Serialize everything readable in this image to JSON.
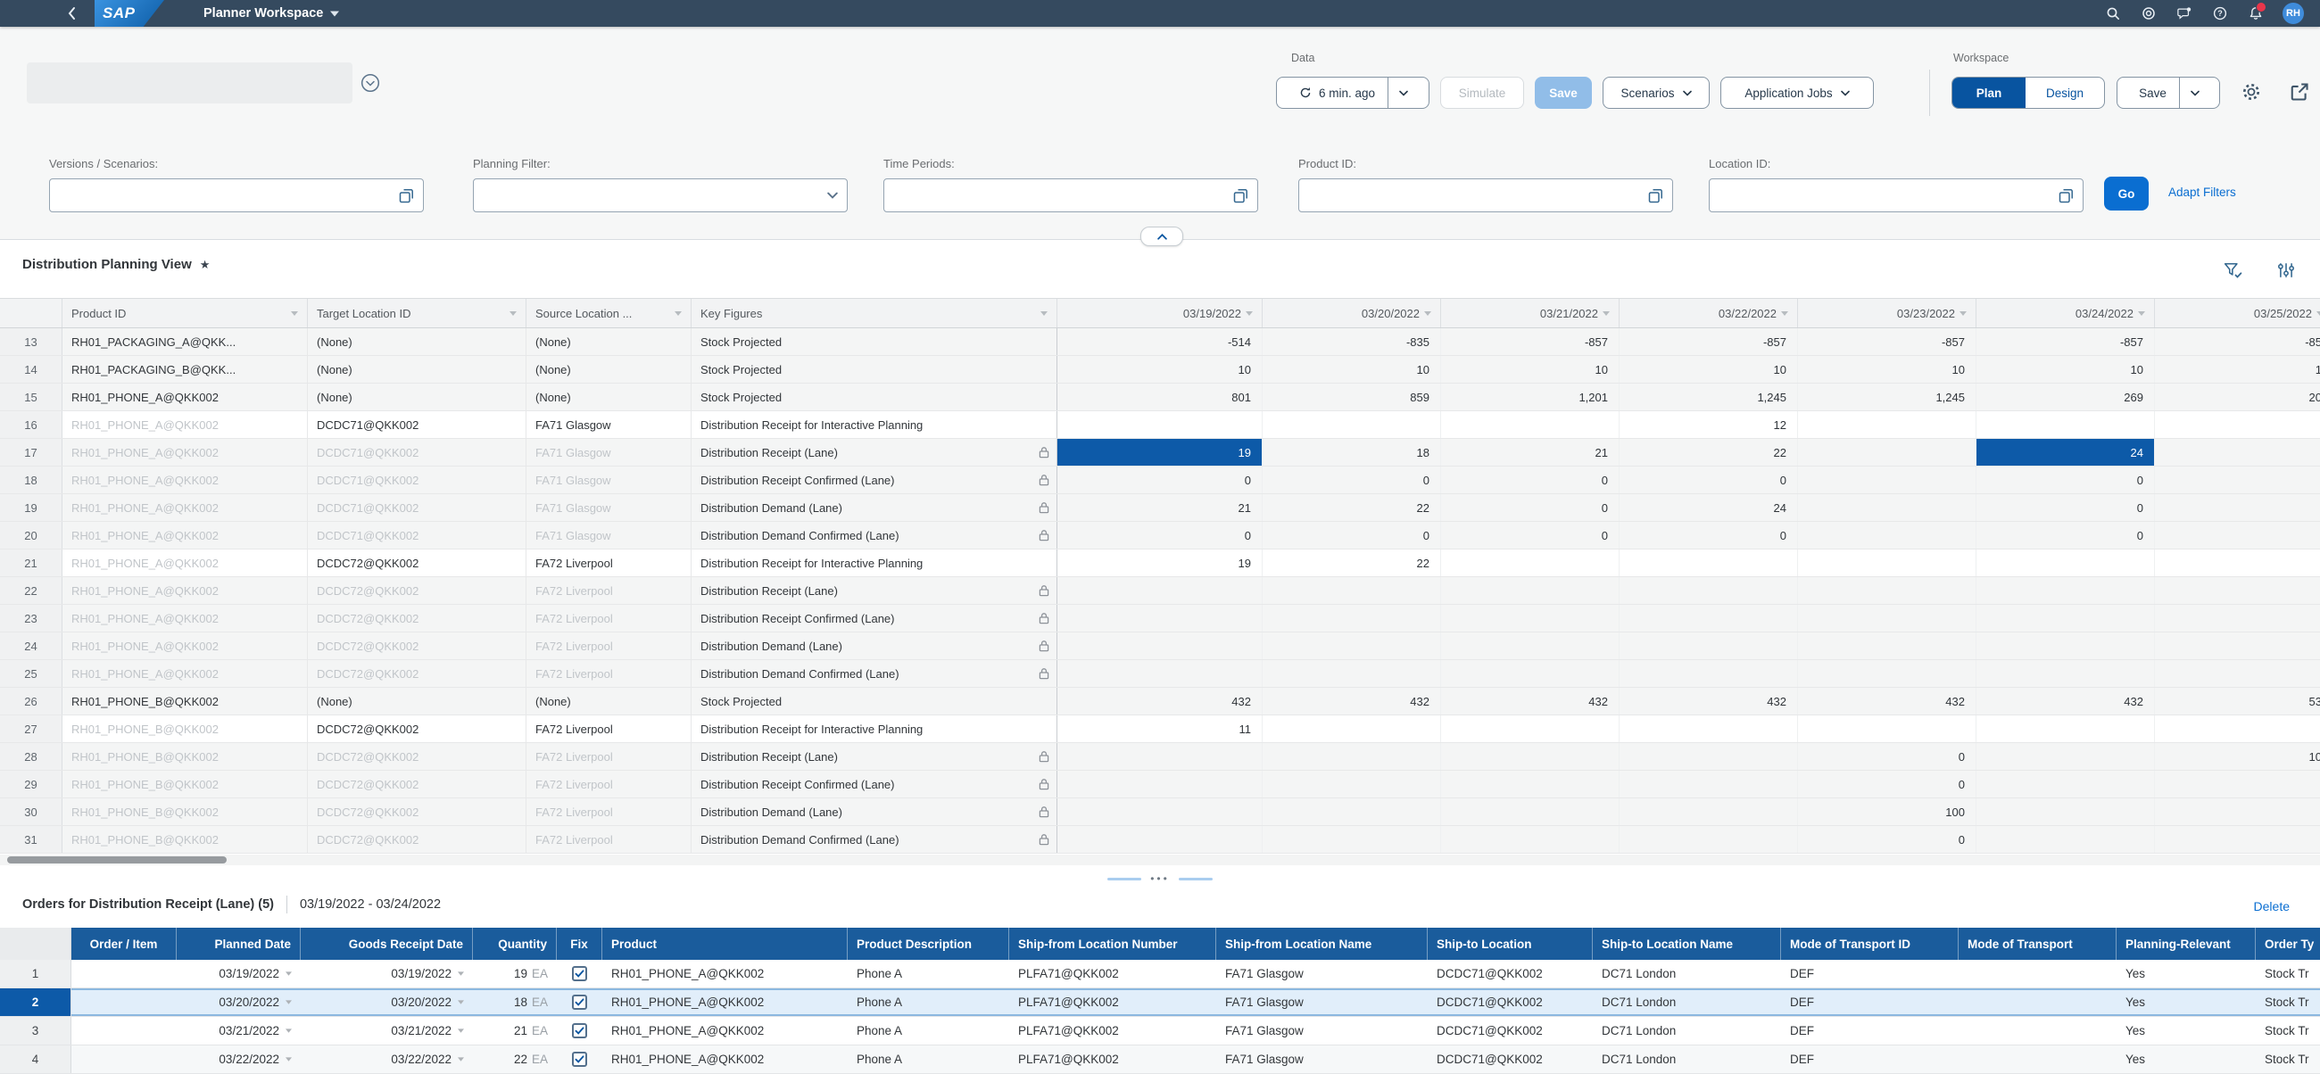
{
  "colors": {
    "shellbar_bg": "#354a5f",
    "accent_blue": "#0a6ed1",
    "selected_cell_blue": "#0d5aa8",
    "orders_header_blue": "#1a5c9c",
    "plan_selected_blue": "#0854a0",
    "save_disabled_bg": "#91bde8",
    "notification_badge_red": "#e9364b"
  },
  "shellbar": {
    "logo": "SAP",
    "title": "Planner Workspace",
    "avatar": "RH"
  },
  "header": {
    "data_label": "Data",
    "refresh_text": "6 min. ago",
    "simulate_label": "Simulate",
    "save_label": "Save",
    "scenarios_label": "Scenarios",
    "application_jobs_label": "Application Jobs",
    "workspace_label": "Workspace",
    "plan_label": "Plan",
    "design_label": "Design",
    "workspace_save_label": "Save"
  },
  "filterbar": {
    "fields": [
      {
        "name": "versions-scenarios",
        "label": "Versions / Scenarios:",
        "kind": "valuehelp",
        "value": ""
      },
      {
        "name": "planning-filter",
        "label": "Planning Filter:",
        "kind": "select",
        "value": ""
      },
      {
        "name": "time-periods",
        "label": "Time Periods:",
        "kind": "valuehelp",
        "value": ""
      },
      {
        "name": "product-id",
        "label": "Product ID:",
        "kind": "valuehelp",
        "value": ""
      },
      {
        "name": "location-id",
        "label": "Location ID:",
        "kind": "valuehelp",
        "value": ""
      }
    ],
    "go_label": "Go",
    "adapt_filters_label": "Adapt Filters"
  },
  "planning": {
    "title": "Distribution Planning View",
    "favorite": "★",
    "fixed_columns": [
      "Product ID",
      "Target Location ID",
      "Source Location ...",
      "Key Figures"
    ],
    "date_columns": [
      "03/19/2022",
      "03/20/2022",
      "03/21/2022",
      "03/22/2022",
      "03/23/2022",
      "03/24/2022",
      "03/25/2022"
    ],
    "rows": [
      {
        "n": "13",
        "p": "RH01_PACKAGING_A@QKK...",
        "pg": 0,
        "t": "(None)",
        "tg": 0,
        "s": "(None)",
        "sg": 0,
        "k": "Stock Projected",
        "lock": 0,
        "edit": 0,
        "vals": [
          "-514",
          "-835",
          "-857",
          "-857",
          "-857",
          "-857",
          "-85"
        ],
        "sel": []
      },
      {
        "n": "14",
        "p": "RH01_PACKAGING_B@QKK...",
        "pg": 0,
        "t": "(None)",
        "tg": 0,
        "s": "(None)",
        "sg": 0,
        "k": "Stock Projected",
        "lock": 0,
        "edit": 0,
        "vals": [
          "10",
          "10",
          "10",
          "10",
          "10",
          "10",
          "1"
        ],
        "sel": []
      },
      {
        "n": "15",
        "p": "RH01_PHONE_A@QKK002",
        "pg": 0,
        "t": "(None)",
        "tg": 0,
        "s": "(None)",
        "sg": 0,
        "k": "Stock Projected",
        "lock": 0,
        "edit": 0,
        "vals": [
          "801",
          "859",
          "1,201",
          "1,245",
          "1,245",
          "269",
          "20"
        ],
        "sel": []
      },
      {
        "n": "16",
        "p": "RH01_PHONE_A@QKK002",
        "pg": 1,
        "t": "DCDC71@QKK002",
        "tg": 0,
        "s": "FA71 Glasgow",
        "sg": 0,
        "k": "Distribution Receipt for Interactive Planning",
        "lock": 0,
        "edit": 1,
        "vals": [
          "",
          "",
          "",
          "12",
          "",
          "",
          ""
        ],
        "sel": []
      },
      {
        "n": "17",
        "p": "RH01_PHONE_A@QKK002",
        "pg": 1,
        "t": "DCDC71@QKK002",
        "tg": 1,
        "s": "FA71 Glasgow",
        "sg": 1,
        "k": "Distribution Receipt (Lane)",
        "lock": 1,
        "edit": 0,
        "vals": [
          "19",
          "18",
          "21",
          "22",
          "",
          "24",
          ""
        ],
        "sel": [
          0,
          5
        ]
      },
      {
        "n": "18",
        "p": "RH01_PHONE_A@QKK002",
        "pg": 1,
        "t": "DCDC71@QKK002",
        "tg": 1,
        "s": "FA71 Glasgow",
        "sg": 1,
        "k": "Distribution Receipt Confirmed (Lane)",
        "lock": 1,
        "edit": 0,
        "vals": [
          "0",
          "0",
          "0",
          "0",
          "",
          "0",
          ""
        ],
        "sel": []
      },
      {
        "n": "19",
        "p": "RH01_PHONE_A@QKK002",
        "pg": 1,
        "t": "DCDC71@QKK002",
        "tg": 1,
        "s": "FA71 Glasgow",
        "sg": 1,
        "k": "Distribution Demand (Lane)",
        "lock": 1,
        "edit": 0,
        "vals": [
          "21",
          "22",
          "0",
          "24",
          "",
          "0",
          ""
        ],
        "sel": []
      },
      {
        "n": "20",
        "p": "RH01_PHONE_A@QKK002",
        "pg": 1,
        "t": "DCDC71@QKK002",
        "tg": 1,
        "s": "FA71 Glasgow",
        "sg": 1,
        "k": "Distribution Demand Confirmed (Lane)",
        "lock": 1,
        "edit": 0,
        "vals": [
          "0",
          "0",
          "0",
          "0",
          "",
          "0",
          ""
        ],
        "sel": []
      },
      {
        "n": "21",
        "p": "RH01_PHONE_A@QKK002",
        "pg": 1,
        "t": "DCDC72@QKK002",
        "tg": 0,
        "s": "FA72 Liverpool",
        "sg": 0,
        "k": "Distribution Receipt for Interactive Planning",
        "lock": 0,
        "edit": 1,
        "vals": [
          "19",
          "22",
          "",
          "",
          "",
          "",
          ""
        ],
        "sel": []
      },
      {
        "n": "22",
        "p": "RH01_PHONE_A@QKK002",
        "pg": 1,
        "t": "DCDC72@QKK002",
        "tg": 1,
        "s": "FA72 Liverpool",
        "sg": 1,
        "k": "Distribution Receipt (Lane)",
        "lock": 1,
        "edit": 0,
        "vals": [
          "",
          "",
          "",
          "",
          "",
          "",
          ""
        ],
        "sel": []
      },
      {
        "n": "23",
        "p": "RH01_PHONE_A@QKK002",
        "pg": 1,
        "t": "DCDC72@QKK002",
        "tg": 1,
        "s": "FA72 Liverpool",
        "sg": 1,
        "k": "Distribution Receipt Confirmed (Lane)",
        "lock": 1,
        "edit": 0,
        "vals": [
          "",
          "",
          "",
          "",
          "",
          "",
          ""
        ],
        "sel": []
      },
      {
        "n": "24",
        "p": "RH01_PHONE_A@QKK002",
        "pg": 1,
        "t": "DCDC72@QKK002",
        "tg": 1,
        "s": "FA72 Liverpool",
        "sg": 1,
        "k": "Distribution Demand (Lane)",
        "lock": 1,
        "edit": 0,
        "vals": [
          "",
          "",
          "",
          "",
          "",
          "",
          ""
        ],
        "sel": []
      },
      {
        "n": "25",
        "p": "RH01_PHONE_A@QKK002",
        "pg": 1,
        "t": "DCDC72@QKK002",
        "tg": 1,
        "s": "FA72 Liverpool",
        "sg": 1,
        "k": "Distribution Demand Confirmed (Lane)",
        "lock": 1,
        "edit": 0,
        "vals": [
          "",
          "",
          "",
          "",
          "",
          "",
          ""
        ],
        "sel": []
      },
      {
        "n": "26",
        "p": "RH01_PHONE_B@QKK002",
        "pg": 0,
        "t": "(None)",
        "tg": 0,
        "s": "(None)",
        "sg": 0,
        "k": "Stock Projected",
        "lock": 0,
        "edit": 0,
        "vals": [
          "432",
          "432",
          "432",
          "432",
          "432",
          "432",
          "53"
        ],
        "sel": []
      },
      {
        "n": "27",
        "p": "RH01_PHONE_B@QKK002",
        "pg": 1,
        "t": "DCDC72@QKK002",
        "tg": 0,
        "s": "FA72 Liverpool",
        "sg": 0,
        "k": "Distribution Receipt for Interactive Planning",
        "lock": 0,
        "edit": 1,
        "vals": [
          "11",
          "",
          "",
          "",
          "",
          "",
          ""
        ],
        "sel": []
      },
      {
        "n": "28",
        "p": "RH01_PHONE_B@QKK002",
        "pg": 1,
        "t": "DCDC72@QKK002",
        "tg": 1,
        "s": "FA72 Liverpool",
        "sg": 1,
        "k": "Distribution Receipt (Lane)",
        "lock": 1,
        "edit": 0,
        "vals": [
          "",
          "",
          "",
          "",
          "0",
          "",
          "10"
        ],
        "sel": []
      },
      {
        "n": "29",
        "p": "RH01_PHONE_B@QKK002",
        "pg": 1,
        "t": "DCDC72@QKK002",
        "tg": 1,
        "s": "FA72 Liverpool",
        "sg": 1,
        "k": "Distribution Receipt Confirmed (Lane)",
        "lock": 1,
        "edit": 0,
        "vals": [
          "",
          "",
          "",
          "",
          "0",
          "",
          ""
        ],
        "sel": []
      },
      {
        "n": "30",
        "p": "RH01_PHONE_B@QKK002",
        "pg": 1,
        "t": "DCDC72@QKK002",
        "tg": 1,
        "s": "FA72 Liverpool",
        "sg": 1,
        "k": "Distribution Demand (Lane)",
        "lock": 1,
        "edit": 0,
        "vals": [
          "",
          "",
          "",
          "",
          "100",
          "",
          ""
        ],
        "sel": []
      },
      {
        "n": "31",
        "p": "RH01_PHONE_B@QKK002",
        "pg": 1,
        "t": "DCDC72@QKK002",
        "tg": 1,
        "s": "FA72 Liverpool",
        "sg": 1,
        "k": "Distribution Demand Confirmed (Lane)",
        "lock": 1,
        "edit": 0,
        "vals": [
          "",
          "",
          "",
          "",
          "0",
          "",
          ""
        ],
        "sel": []
      }
    ]
  },
  "orders": {
    "title": "Orders for Distribution Receipt (Lane) (5)",
    "date_range": "03/19/2022 - 03/24/2022",
    "delete_label": "Delete",
    "columns": [
      "Order / Item",
      "Planned Date",
      "Goods Receipt Date",
      "Quantity",
      "Fix",
      "Product",
      "Product Description",
      "Ship-from Location Number",
      "Ship-from Location Name",
      "Ship-to Location",
      "Ship-to Location Name",
      "Mode of Transport ID",
      "Mode of Transport",
      "Planning-Relevant",
      "Order Ty"
    ],
    "rows": [
      {
        "n": "1",
        "order_item": "",
        "planned_date": "03/19/2022",
        "goods_receipt_date": "03/19/2022",
        "quantity": "19",
        "uom": "EA",
        "fix": true,
        "product": "RH01_PHONE_A@QKK002",
        "description": "Phone A",
        "ship_from_number": "PLFA71@QKK002",
        "ship_from_name": "FA71 Glasgow",
        "ship_to_location": "DCDC71@QKK002",
        "ship_to_name": "DC71 London",
        "mot_id": "DEF",
        "mot": "",
        "planning_relevant": "Yes",
        "order_type": "Stock Tr",
        "selected": false
      },
      {
        "n": "2",
        "order_item": "",
        "planned_date": "03/20/2022",
        "goods_receipt_date": "03/20/2022",
        "quantity": "18",
        "uom": "EA",
        "fix": true,
        "product": "RH01_PHONE_A@QKK002",
        "description": "Phone A",
        "ship_from_number": "PLFA71@QKK002",
        "ship_from_name": "FA71 Glasgow",
        "ship_to_location": "DCDC71@QKK002",
        "ship_to_name": "DC71 London",
        "mot_id": "DEF",
        "mot": "",
        "planning_relevant": "Yes",
        "order_type": "Stock Tr",
        "selected": true
      },
      {
        "n": "3",
        "order_item": "",
        "planned_date": "03/21/2022",
        "goods_receipt_date": "03/21/2022",
        "quantity": "21",
        "uom": "EA",
        "fix": true,
        "product": "RH01_PHONE_A@QKK002",
        "description": "Phone A",
        "ship_from_number": "PLFA71@QKK002",
        "ship_from_name": "FA71 Glasgow",
        "ship_to_location": "DCDC71@QKK002",
        "ship_to_name": "DC71 London",
        "mot_id": "DEF",
        "mot": "",
        "planning_relevant": "Yes",
        "order_type": "Stock Tr",
        "selected": false
      },
      {
        "n": "4",
        "order_item": "",
        "planned_date": "03/22/2022",
        "goods_receipt_date": "03/22/2022",
        "quantity": "22",
        "uom": "EA",
        "fix": true,
        "product": "RH01_PHONE_A@QKK002",
        "description": "Phone A",
        "ship_from_number": "PLFA71@QKK002",
        "ship_from_name": "FA71 Glasgow",
        "ship_to_location": "DCDC71@QKK002",
        "ship_to_name": "DC71 London",
        "mot_id": "DEF",
        "mot": "",
        "planning_relevant": "Yes",
        "order_type": "Stock Tr",
        "selected": false
      }
    ]
  },
  "misc": {
    "grip_dots": "•••"
  },
  "icon_names": [
    "back-icon",
    "search-icon",
    "copilot-icon",
    "chat-icon",
    "help-icon",
    "bell-icon",
    "refresh-icon",
    "chevron-down-icon",
    "chevron-up-icon",
    "gear-icon",
    "share-icon",
    "value-help-icon",
    "select-chevron-icon",
    "favorite-star-icon",
    "filter-icon",
    "table-settings-icon",
    "lock-icon",
    "checkbox-check-icon",
    "filter-marker-icon",
    "circle-chevron-icon"
  ]
}
